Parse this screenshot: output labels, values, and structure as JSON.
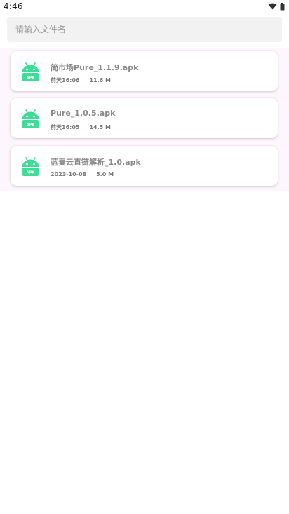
{
  "status_bar": {
    "time": "4:46"
  },
  "search": {
    "placeholder": "请输入文件名",
    "value": ""
  },
  "files": [
    {
      "name": "简市场Pure_1.1.9.apk",
      "date": "前天16:06",
      "size": "11.6 M",
      "icon_label": "APK"
    },
    {
      "name": "Pure_1.0.5.apk",
      "date": "前天16:05",
      "size": "14.5 M",
      "icon_label": "APK"
    },
    {
      "name": "蓝奏云直链解析_1.0.apk",
      "date": "2023-10-08",
      "size": "5.0 M",
      "icon_label": "APK"
    }
  ],
  "colors": {
    "accent": "#3ddc97",
    "list_background": "#fdf7fd",
    "search_background": "#f2f2f2"
  }
}
